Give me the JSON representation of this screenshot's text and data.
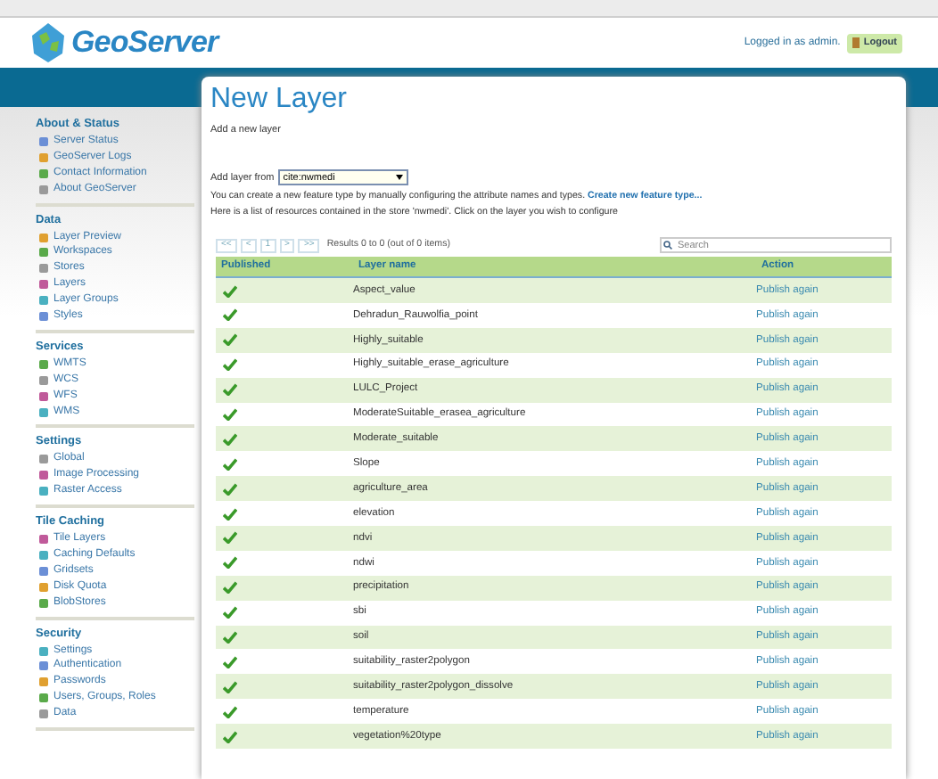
{
  "header": {
    "logo_text": "GeoServer",
    "login_status": "Logged in as admin.",
    "logout_button": "Logout"
  },
  "sidebar": {
    "sections": [
      {
        "title": "About & Status",
        "items": [
          "Server Status",
          "GeoServer Logs",
          "Contact Information",
          "About GeoServer"
        ]
      },
      {
        "title": "Data",
        "items": [
          "Layer Preview",
          "Workspaces",
          "Stores",
          "Layers",
          "Layer Groups",
          "Styles"
        ]
      },
      {
        "title": "Services",
        "items": [
          "WMTS",
          "WCS",
          "WFS",
          "WMS"
        ]
      },
      {
        "title": "Settings",
        "items": [
          "Global",
          "Image Processing",
          "Raster Access"
        ]
      },
      {
        "title": "Tile Caching",
        "items": [
          "Tile Layers",
          "Caching Defaults",
          "Gridsets",
          "Disk Quota",
          "BlobStores"
        ]
      },
      {
        "title": "Security",
        "items": [
          "Settings",
          "Authentication",
          "Passwords",
          "Users, Groups, Roles",
          "Data"
        ]
      }
    ]
  },
  "page": {
    "title": "New Layer",
    "subtitle": "Add a new layer",
    "source_label": "Add layer from",
    "source_value": "cite:nwmedi",
    "info_text": "You can create a new feature type by manually configuring the attribute names and types.",
    "create_link": "Create new feature type...",
    "store_text": "Here is a list of resources contained in the store 'nwmedi'. Click on the layer you wish to configure",
    "pager": [
      "<<",
      "<",
      "1",
      ">",
      ">>"
    ],
    "results": "Results 0 to 0 (out of 0 items)",
    "search": {
      "placeholder": "Search"
    }
  },
  "table": {
    "columns": [
      "Published",
      "Layer name",
      "Action"
    ],
    "rows": [
      {
        "published": true,
        "name": "Aspect_value",
        "action": "Publish again"
      },
      {
        "published": true,
        "name": "Dehradun_Rauwolfia_point",
        "action": "Publish again"
      },
      {
        "published": true,
        "name": "Highly_suitable",
        "action": "Publish again"
      },
      {
        "published": true,
        "name": "Highly_suitable_erase_agriculture",
        "action": "Publish again"
      },
      {
        "published": true,
        "name": "LULC_Project",
        "action": "Publish again"
      },
      {
        "published": true,
        "name": "ModerateSuitable_erasea_agriculture",
        "action": "Publish again"
      },
      {
        "published": true,
        "name": "Moderate_suitable",
        "action": "Publish again"
      },
      {
        "published": true,
        "name": "Slope",
        "action": "Publish again"
      },
      {
        "published": true,
        "name": "agriculture_area",
        "action": "Publish again"
      },
      {
        "published": true,
        "name": "elevation",
        "action": "Publish again"
      },
      {
        "published": true,
        "name": "ndvi",
        "action": "Publish again"
      },
      {
        "published": true,
        "name": "ndwi",
        "action": "Publish again"
      },
      {
        "published": true,
        "name": "precipitation",
        "action": "Publish again"
      },
      {
        "published": true,
        "name": "sbi",
        "action": "Publish again"
      },
      {
        "published": true,
        "name": "soil",
        "action": "Publish again"
      },
      {
        "published": true,
        "name": "suitability_raster2polygon",
        "action": "Publish again"
      },
      {
        "published": true,
        "name": "suitability_raster2polygon_dissolve",
        "action": "Publish again"
      },
      {
        "published": true,
        "name": "temperature",
        "action": "Publish again"
      },
      {
        "published": true,
        "name": "vegetation%20type",
        "action": "Publish again"
      }
    ]
  }
}
